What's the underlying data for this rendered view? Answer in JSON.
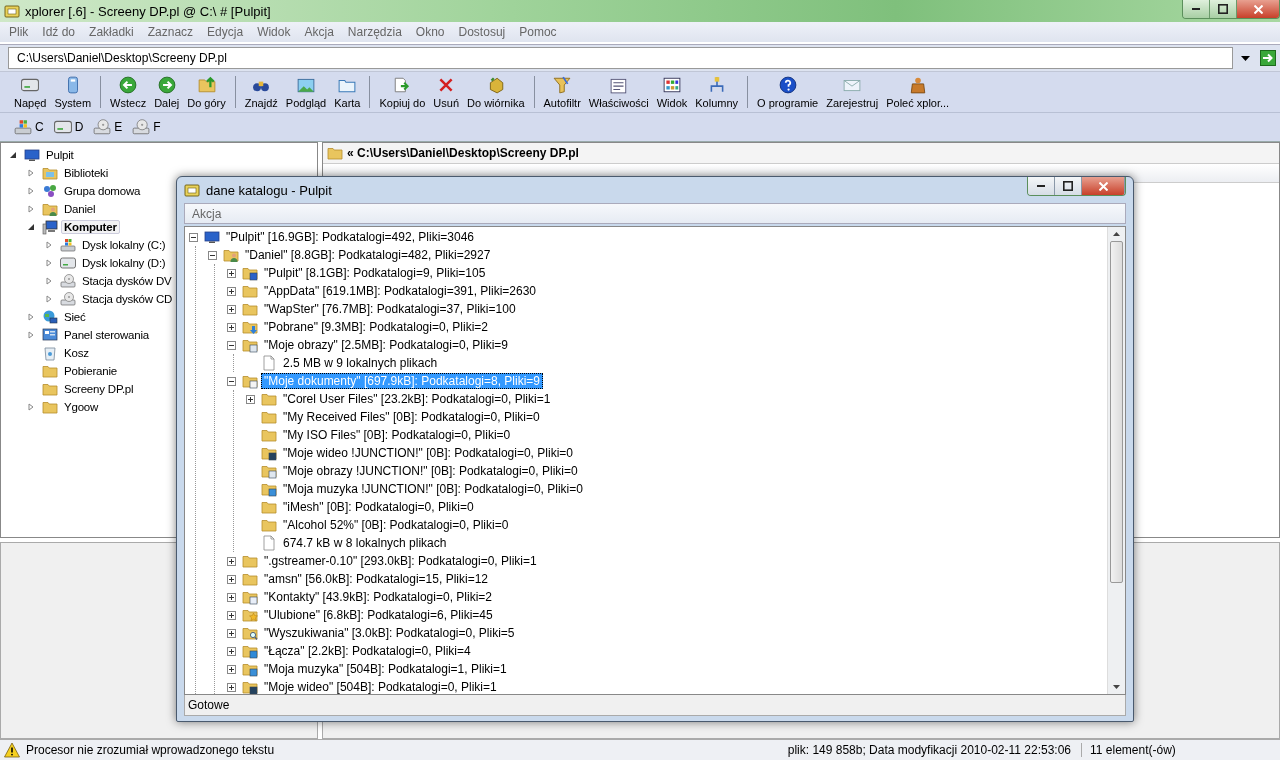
{
  "window": {
    "title": "xplorer [.6] - Screeny DP.pl @ C:\\ # [Pulpit]"
  },
  "menu": [
    "Plik",
    "Idź do",
    "Zakładki",
    "Zaznacz",
    "Edycja",
    "Widok",
    "Akcja",
    "Narzędzia",
    "Okno",
    "Dostosuj",
    "Pomoc"
  ],
  "address": {
    "value": "C:\\Users\\Daniel\\Desktop\\Screeny DP.pl"
  },
  "toolbar": [
    [
      {
        "label": "Napęd",
        "kind": "drive"
      },
      {
        "label": "System",
        "kind": "system"
      }
    ],
    [
      {
        "label": "Wstecz",
        "kind": "back"
      },
      {
        "label": "Dalej",
        "kind": "forward"
      },
      {
        "label": "Do góry",
        "kind": "up"
      }
    ],
    [
      {
        "label": "Znajdź",
        "kind": "find"
      },
      {
        "label": "Podgląd",
        "kind": "preview"
      },
      {
        "label": "Karta",
        "kind": "tab"
      }
    ],
    [
      {
        "label": "Kopiuj do",
        "kind": "copy"
      },
      {
        "label": "Usuń",
        "kind": "delete"
      },
      {
        "label": "Do wiórnika",
        "kind": "shredder"
      }
    ],
    [
      {
        "label": "Autofiltr",
        "kind": "filter"
      },
      {
        "label": "Właściwości",
        "kind": "properties"
      },
      {
        "label": "Widok",
        "kind": "view"
      },
      {
        "label": "Kolumny",
        "kind": "columns"
      }
    ],
    [
      {
        "label": "O programie",
        "kind": "help"
      },
      {
        "label": "Zarejestruj",
        "kind": "register"
      },
      {
        "label": "Poleć xplor...",
        "kind": "recommend"
      }
    ]
  ],
  "drives": [
    {
      "label": "C",
      "kind": "windows"
    },
    {
      "label": "D",
      "kind": "drive"
    },
    {
      "label": "E",
      "kind": "optical"
    },
    {
      "label": "F",
      "kind": "optical"
    }
  ],
  "folder_tree": [
    {
      "label": "Pulpit",
      "kind": "desktop",
      "expanded": true,
      "selected": false,
      "children": [
        {
          "label": "Biblioteki",
          "kind": "libraries",
          "expanded": false,
          "selected": false
        },
        {
          "label": "Grupa domowa",
          "kind": "homegroup",
          "expanded": false,
          "selected": false
        },
        {
          "label": "Daniel",
          "kind": "user",
          "expanded": false,
          "selected": false
        },
        {
          "label": "Komputer",
          "kind": "computer",
          "expanded": true,
          "selected": true,
          "children": [
            {
              "label": "Dysk lokalny (C:)",
              "kind": "windows",
              "expanded": false,
              "selected": false
            },
            {
              "label": "Dysk lokalny (D:)",
              "kind": "drive",
              "expanded": false,
              "selected": false
            },
            {
              "label": "Stacja dysków DV",
              "kind": "optical",
              "expanded": false,
              "selected": false
            },
            {
              "label": "Stacja dysków CD",
              "kind": "optical",
              "expanded": false,
              "selected": false
            }
          ]
        },
        {
          "label": "Sieć",
          "kind": "network",
          "expanded": false,
          "selected": false
        },
        {
          "label": "Panel sterowania",
          "kind": "control",
          "expanded": false,
          "selected": false
        },
        {
          "label": "Kosz",
          "kind": "trash",
          "selected": false
        },
        {
          "label": "Pobieranie",
          "kind": "folder",
          "selected": false
        },
        {
          "label": "Screeny DP.pl",
          "kind": "folder",
          "selected": false
        },
        {
          "label": "Ygoow",
          "kind": "folder",
          "expanded": false,
          "selected": false
        }
      ]
    }
  ],
  "path_header": "« C:\\Users\\Daniel\\Desktop\\Screeny DP.pl",
  "status_bar": {
    "message": "Procesor nie zrozumiał wprowadzonego tekstu",
    "file_info": "plik: 149 858b; Data modyfikacji 2010-02-11 22:53:06",
    "count": "11 element(-ów)"
  },
  "dialog": {
    "title": "dane katalogu - Pulpit",
    "menu": [
      "Akcja"
    ],
    "status": "Gotowe",
    "tree": [
      {
        "label": "\"Pulpit\" [16.9GB]: Podkatalogi=492, Pliki=3046",
        "kind": "desktop",
        "expanded": true,
        "selected": false,
        "children": [
          {
            "label": "\"Daniel\" [8.8GB]: Podkatalogi=482, Pliki=2927",
            "kind": "user",
            "expanded": true,
            "selected": false,
            "children": [
              {
                "label": "\"Pulpit\" [8.1GB]: Podkatalogi=9, Pliki=105",
                "kind": "desktop-folder",
                "expanded": false,
                "selected": false
              },
              {
                "label": "\"AppData\" [619.1MB]: Podkatalogi=391, Pliki=2630",
                "kind": "folder",
                "expanded": false,
                "selected": false
              },
              {
                "label": "\"WapSter\" [76.7MB]: Podkatalogi=37, Pliki=100",
                "kind": "folder",
                "expanded": false,
                "selected": false
              },
              {
                "label": "\"Pobrane\" [9.3MB]: Podkatalogi=0, Pliki=2",
                "kind": "download",
                "expanded": false,
                "selected": false
              },
              {
                "label": "\"Moje obrazy\" [2.5MB]: Podkatalogi=0, Pliki=9",
                "kind": "pictures",
                "expanded": true,
                "selected": false,
                "children": [
                  {
                    "label": "2.5 MB w 9 lokalnych plikach",
                    "kind": "file",
                    "selected": false
                  }
                ]
              },
              {
                "label": "\"Moje dokumenty\" [697.9kB]: Podkatalogi=8, Pliki=9",
                "kind": "documents",
                "expanded": true,
                "selected": true,
                "children": [
                  {
                    "label": "\"Corel User Files\" [23.2kB]: Podkatalogi=0, Pliki=1",
                    "kind": "folder",
                    "expanded": false,
                    "selected": false
                  },
                  {
                    "label": "\"My Received Files\" [0B]: Podkatalogi=0, Pliki=0",
                    "kind": "folder",
                    "selected": false
                  },
                  {
                    "label": "\"My ISO Files\" [0B]: Podkatalogi=0, Pliki=0",
                    "kind": "folder",
                    "selected": false
                  },
                  {
                    "label": "\"Moje wideo !JUNCTION!\" [0B]: Podkatalogi=0, Pliki=0",
                    "kind": "video",
                    "selected": false
                  },
                  {
                    "label": "\"Moje obrazy !JUNCTION!\" [0B]: Podkatalogi=0, Pliki=0",
                    "kind": "pictures",
                    "selected": false
                  },
                  {
                    "label": "\"Moja muzyka !JUNCTION!\" [0B]: Podkatalogi=0, Pliki=0",
                    "kind": "music",
                    "selected": false
                  },
                  {
                    "label": "\"iMesh\" [0B]: Podkatalogi=0, Pliki=0",
                    "kind": "folder",
                    "selected": false
                  },
                  {
                    "label": "\"Alcohol 52%\" [0B]: Podkatalogi=0, Pliki=0",
                    "kind": "folder",
                    "selected": false
                  },
                  {
                    "label": "674.7 kB w 8 lokalnych plikach",
                    "kind": "file",
                    "selected": false
                  }
                ]
              },
              {
                "label": "\".gstreamer-0.10\" [293.0kB]: Podkatalogi=0, Pliki=1",
                "kind": "folder",
                "expanded": false,
                "selected": false
              },
              {
                "label": "\"amsn\" [56.0kB]: Podkatalogi=15, Pliki=12",
                "kind": "folder",
                "expanded": false,
                "selected": false
              },
              {
                "label": "\"Kontakty\" [43.9kB]: Podkatalogi=0, Pliki=2",
                "kind": "contacts",
                "expanded": false,
                "selected": false
              },
              {
                "label": "\"Ulubione\" [6.8kB]: Podkatalogi=6, Pliki=45",
                "kind": "favorites",
                "expanded": false,
                "selected": false
              },
              {
                "label": "\"Wyszukiwania\" [3.0kB]: Podkatalogi=0, Pliki=5",
                "kind": "searches",
                "expanded": false,
                "selected": false
              },
              {
                "label": "\"Łącza\" [2.2kB]: Podkatalogi=0, Pliki=4",
                "kind": "links",
                "expanded": false,
                "selected": false
              },
              {
                "label": "\"Moja muzyka\" [504B]: Podkatalogi=1, Pliki=1",
                "kind": "music",
                "expanded": false,
                "selected": false
              },
              {
                "label": "\"Moje wideo\" [504B]: Podkatalogi=0, Pliki=1",
                "kind": "video",
                "expanded": false,
                "selected": false
              }
            ]
          }
        ]
      }
    ]
  }
}
